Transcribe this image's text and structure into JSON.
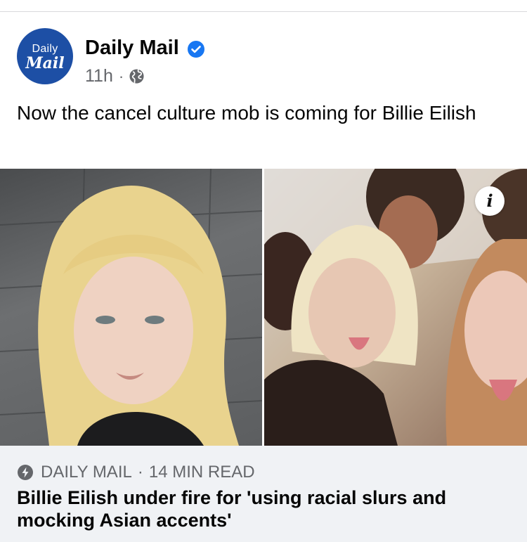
{
  "post": {
    "page_name": "Daily Mail",
    "avatar": {
      "line1": "Daily",
      "line2": "Mail"
    },
    "verified": true,
    "time": "11h",
    "dot": "·",
    "audience_icon": "globe-icon",
    "text": "Now the cancel culture mob is coming for Billie Eilish"
  },
  "media": {
    "images": [
      "billie-eilish-portrait",
      "group-photo"
    ],
    "info_label": "i"
  },
  "link_preview": {
    "source": "DAILY MAIL",
    "separator": "·",
    "read_time": "14 MIN READ",
    "headline": "Billie Eilish under fire for 'using racial slurs and mocking Asian accents'",
    "icon": "lightning-bolt-icon"
  },
  "colors": {
    "verified_blue": "#1877f2",
    "avatar_blue": "#1d4fa5",
    "meta_gray": "#65676b",
    "card_bg": "#f0f2f5"
  }
}
